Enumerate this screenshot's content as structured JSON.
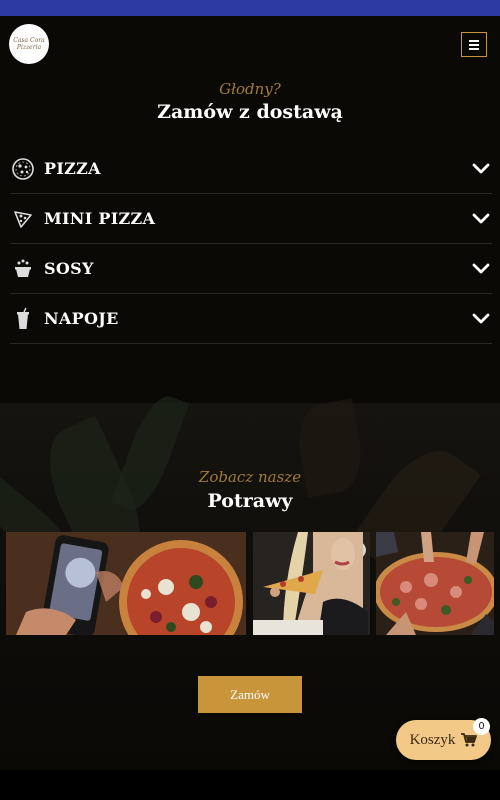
{
  "header": {
    "logo_text": "Casa Cora Pizzeria",
    "menu_icon": "hamburger-icon"
  },
  "order_section": {
    "kicker": "Głodny?",
    "title": "Zamów z dostawą",
    "categories": [
      {
        "label": "PIZZA",
        "icon": "pizza-icon"
      },
      {
        "label": "MINI PIZZA",
        "icon": "pizza-slice-icon"
      },
      {
        "label": "SOSY",
        "icon": "sauce-icon"
      },
      {
        "label": "NAPOJE",
        "icon": "drink-icon"
      }
    ]
  },
  "gallery": {
    "kicker": "Zobacz nasze",
    "title": "Potrawy",
    "photos": [
      "pizza-phone-photo",
      "pizza-eating-photo",
      "pizza-sharing-photo"
    ]
  },
  "cta": {
    "order_label": "Zamów"
  },
  "cart": {
    "label": "Koszyk",
    "count": "0",
    "icon": "cart-icon"
  },
  "colors": {
    "accent": "#c8953a",
    "cart_bg": "#f2c986",
    "top_bar": "#2e3aa3",
    "background": "#0b0906"
  }
}
